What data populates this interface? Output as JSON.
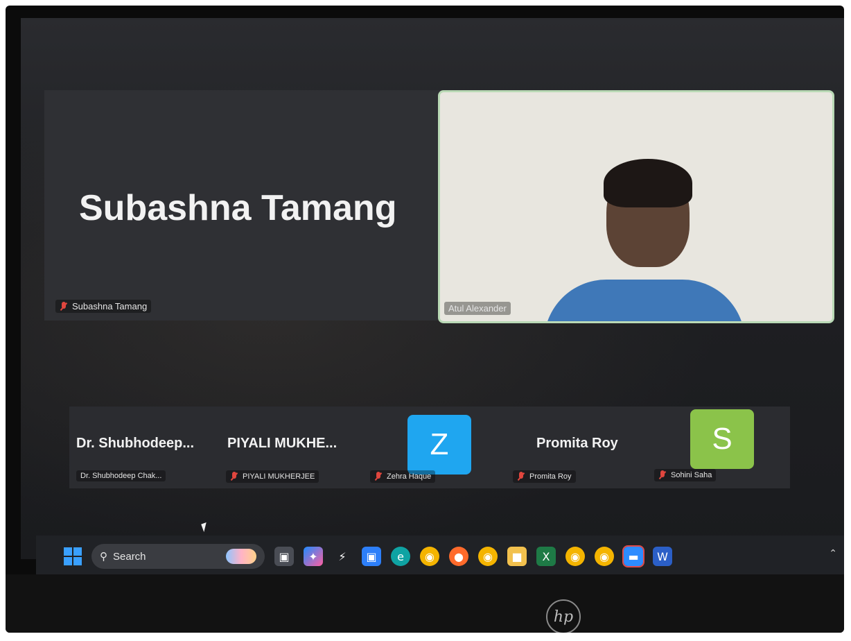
{
  "speaker": {
    "big_name": "Subashna Tamang",
    "tag_name": "Subashna Tamang"
  },
  "video": {
    "tag_name": "Atul Alexander"
  },
  "gallery": [
    {
      "display_name": "Dr. Shubhodeep...",
      "tag_name": "Dr. Shubhodeep Chak..."
    },
    {
      "display_name": "PIYALI MUKHE...",
      "tag_name": "PIYALI MUKHERJEE"
    },
    {
      "avatar_letter": "Z",
      "avatar_color": "#1fa6f0",
      "tag_name": "Zehra Haque"
    },
    {
      "display_name": "Promita Roy",
      "tag_name": "Promita Roy"
    },
    {
      "avatar_letter": "S",
      "avatar_color": "#8bc34a",
      "tag_name": "Sohini Saha"
    }
  ],
  "taskbar": {
    "search_label": "Search",
    "icons": [
      "start-icon",
      "search-icon",
      "task-view-icon",
      "copilot-icon",
      "lightning-icon",
      "store-icon",
      "edge-icon",
      "chrome-icon",
      "firefox-icon",
      "chrome-icon-2",
      "file-explorer-icon",
      "excel-icon",
      "chrome-icon-3",
      "chrome-icon-4",
      "zoom-icon",
      "word-icon"
    ]
  },
  "laptop": {
    "brand": "hp"
  }
}
